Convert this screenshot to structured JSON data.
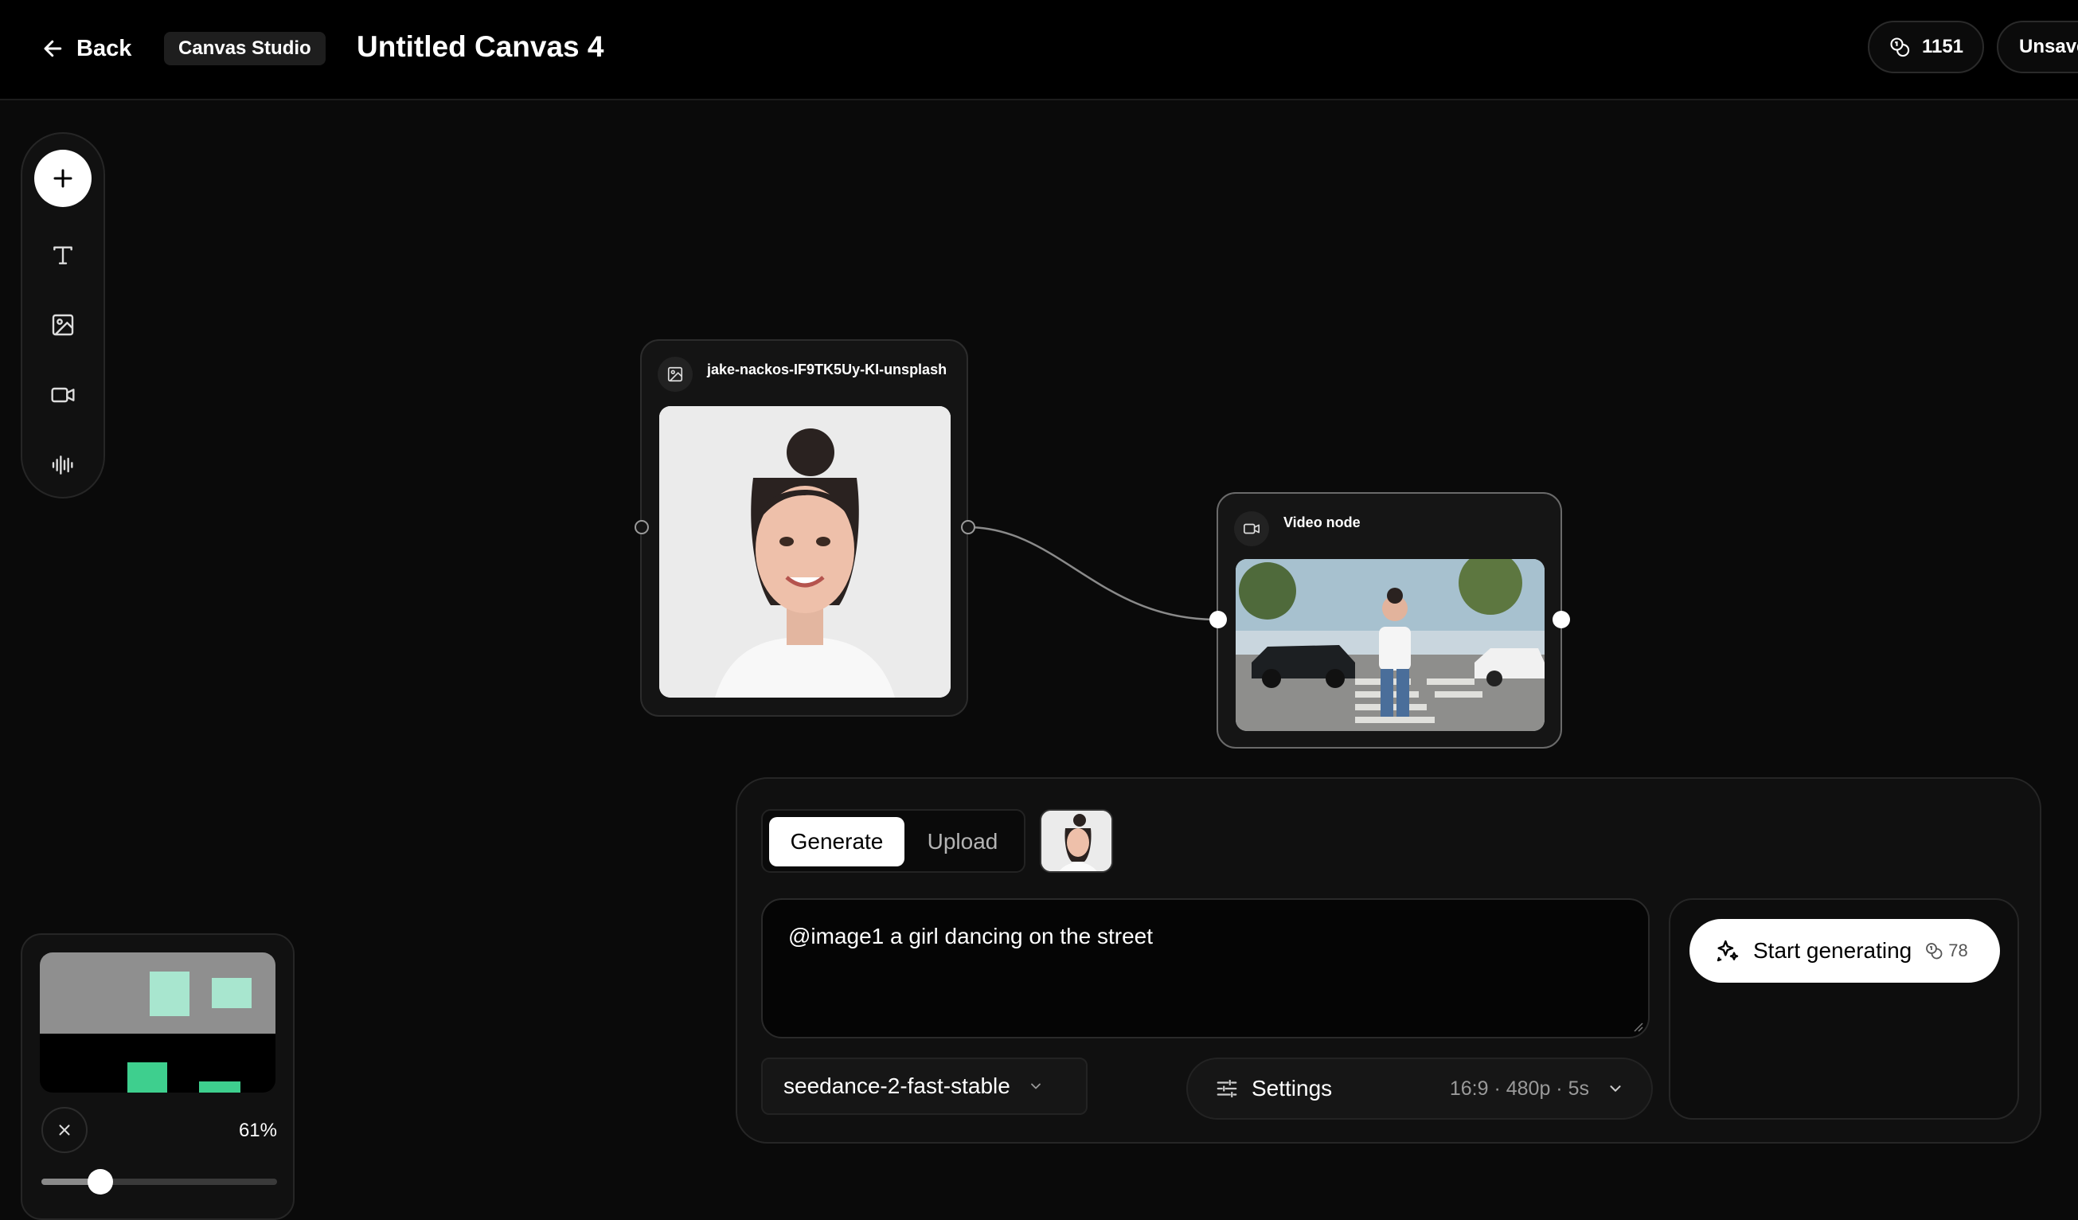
{
  "header": {
    "back_label": "Back",
    "studio_label": "Canvas Studio",
    "canvas_title": "Untitled Canvas 4",
    "credits": "1151",
    "save_status": "Unsaved"
  },
  "toolbar": {
    "tools": [
      "add",
      "text",
      "image",
      "video",
      "audio"
    ]
  },
  "nodes": {
    "image_node": {
      "title": "jake-nackos-IF9TK5Uy-KI-unsplash"
    },
    "video_node": {
      "title": "Video node"
    }
  },
  "generate_panel": {
    "tab_generate": "Generate",
    "tab_upload": "Upload",
    "prompt": "@image1 a girl dancing on the street",
    "model": "seedance-2-fast-stable",
    "settings_label": "Settings",
    "settings_summary": "16:9 · 480p · 5s",
    "start_label": "Start generating",
    "start_cost": "78"
  },
  "minimap": {
    "zoom_label": "61%",
    "zoom_fraction": 0.25
  },
  "colors": {
    "background": "#0a0a0a",
    "accent_green": "#3ecf8e",
    "minimap_node": "#a8e6cf"
  }
}
